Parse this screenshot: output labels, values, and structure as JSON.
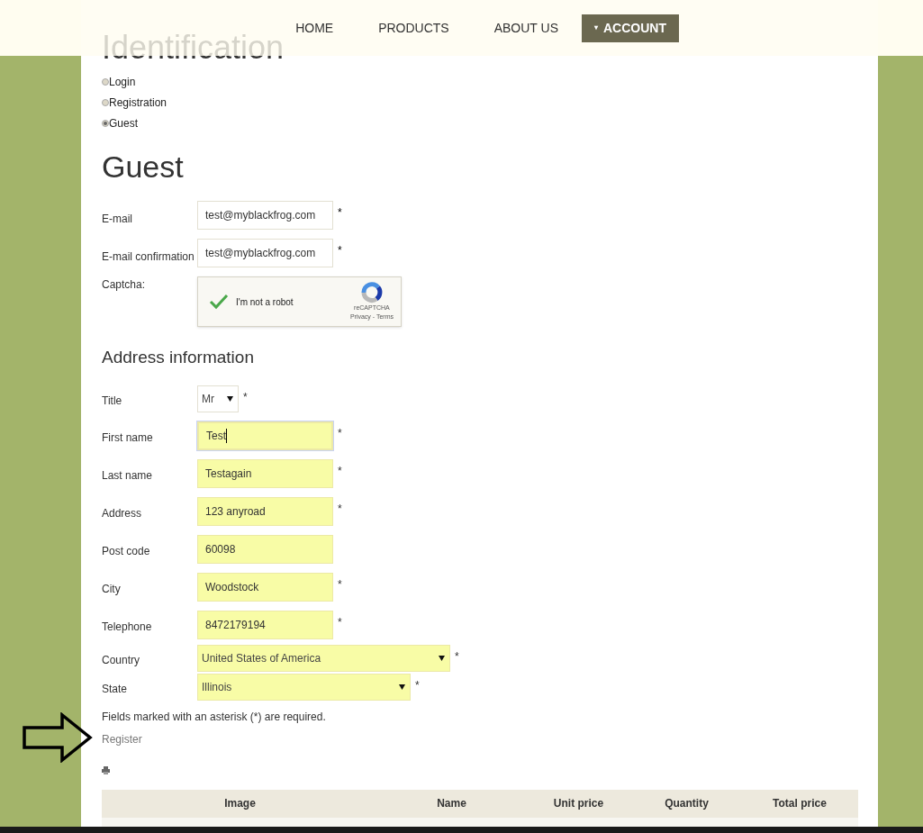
{
  "nav": [
    {
      "label": "HOME",
      "selected": false
    },
    {
      "label": "PRODUCTS",
      "selected": false
    },
    {
      "label": "ABOUT US",
      "selected": false
    },
    {
      "label": "ACCOUNT",
      "selected": true,
      "caret": "▾"
    }
  ],
  "heading": "Identification",
  "modes": [
    {
      "label": "Login",
      "selected": false
    },
    {
      "label": "Registration",
      "selected": false
    },
    {
      "label": "Guest",
      "selected": true
    }
  ],
  "section_title": "Guest",
  "account_fields": [
    {
      "label": "E-mail",
      "value": "test@myblackfrog.com",
      "required": "*"
    },
    {
      "label": "E-mail confirmation",
      "value": "test@myblackfrog.com",
      "required": "*"
    }
  ],
  "captcha": {
    "label": "Captcha:",
    "checked": true,
    "text": "I'm not a robot",
    "brand": "reCAPTCHA",
    "links": "Privacy - Terms"
  },
  "address_title": "Address information",
  "address_fields": [
    {
      "kind": "select",
      "label": "Title",
      "value": "Mr",
      "required": "*",
      "autofilled": false,
      "focused": false
    },
    {
      "kind": "input",
      "label": "First name",
      "value": "Test",
      "required": "*",
      "autofilled": true,
      "focused": true
    },
    {
      "kind": "input",
      "label": "Last name",
      "value": "Testagain",
      "required": "*",
      "autofilled": true,
      "focused": false
    },
    {
      "kind": "input",
      "label": "Address",
      "value": "123 anyroad",
      "required": "*",
      "autofilled": true,
      "focused": false
    },
    {
      "kind": "input",
      "label": "Post code",
      "value": "60098",
      "autofilled": true,
      "focused": false
    },
    {
      "kind": "input",
      "label": "City",
      "value": "Woodstock",
      "required": "*",
      "autofilled": true,
      "focused": false
    },
    {
      "kind": "input",
      "label": "Telephone",
      "value": "8472179194",
      "required": "*",
      "autofilled": true,
      "focused": false
    },
    {
      "kind": "wide-select",
      "label": "Country",
      "value": "United States of America",
      "required": "*",
      "autofilled": true,
      "focused": false
    },
    {
      "kind": "medium-select",
      "label": "State",
      "value": "Illinois",
      "required": "*",
      "autofilled": true,
      "focused": false
    }
  ],
  "note": "Fields marked with an asterisk (*) are required.",
  "register_link": "Register",
  "table": {
    "columns": [
      "Image",
      "Name",
      "Unit price",
      "Quantity",
      "Total price"
    ]
  }
}
